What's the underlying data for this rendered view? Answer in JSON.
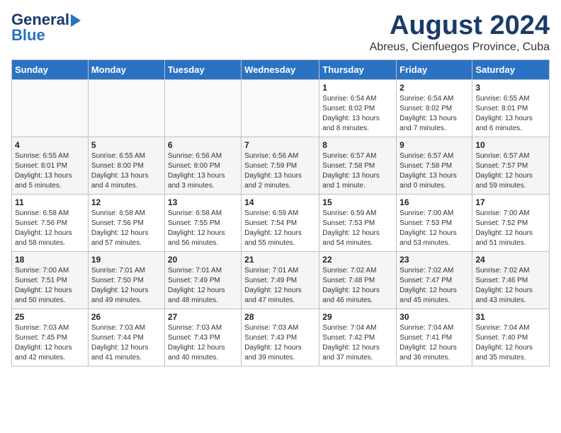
{
  "header": {
    "logo_line1": "General",
    "logo_line2": "Blue",
    "month_title": "August 2024",
    "subtitle": "Abreus, Cienfuegos Province, Cuba"
  },
  "days_of_week": [
    "Sunday",
    "Monday",
    "Tuesday",
    "Wednesday",
    "Thursday",
    "Friday",
    "Saturday"
  ],
  "weeks": [
    [
      {
        "day": "",
        "info": ""
      },
      {
        "day": "",
        "info": ""
      },
      {
        "day": "",
        "info": ""
      },
      {
        "day": "",
        "info": ""
      },
      {
        "day": "1",
        "info": "Sunrise: 6:54 AM\nSunset: 8:02 PM\nDaylight: 13 hours\nand 8 minutes."
      },
      {
        "day": "2",
        "info": "Sunrise: 6:54 AM\nSunset: 8:02 PM\nDaylight: 13 hours\nand 7 minutes."
      },
      {
        "day": "3",
        "info": "Sunrise: 6:55 AM\nSunset: 8:01 PM\nDaylight: 13 hours\nand 6 minutes."
      }
    ],
    [
      {
        "day": "4",
        "info": "Sunrise: 6:55 AM\nSunset: 8:01 PM\nDaylight: 13 hours\nand 5 minutes."
      },
      {
        "day": "5",
        "info": "Sunrise: 6:55 AM\nSunset: 8:00 PM\nDaylight: 13 hours\nand 4 minutes."
      },
      {
        "day": "6",
        "info": "Sunrise: 6:56 AM\nSunset: 8:00 PM\nDaylight: 13 hours\nand 3 minutes."
      },
      {
        "day": "7",
        "info": "Sunrise: 6:56 AM\nSunset: 7:59 PM\nDaylight: 13 hours\nand 2 minutes."
      },
      {
        "day": "8",
        "info": "Sunrise: 6:57 AM\nSunset: 7:58 PM\nDaylight: 13 hours\nand 1 minute."
      },
      {
        "day": "9",
        "info": "Sunrise: 6:57 AM\nSunset: 7:58 PM\nDaylight: 13 hours\nand 0 minutes."
      },
      {
        "day": "10",
        "info": "Sunrise: 6:57 AM\nSunset: 7:57 PM\nDaylight: 12 hours\nand 59 minutes."
      }
    ],
    [
      {
        "day": "11",
        "info": "Sunrise: 6:58 AM\nSunset: 7:56 PM\nDaylight: 12 hours\nand 58 minutes."
      },
      {
        "day": "12",
        "info": "Sunrise: 6:58 AM\nSunset: 7:56 PM\nDaylight: 12 hours\nand 57 minutes."
      },
      {
        "day": "13",
        "info": "Sunrise: 6:58 AM\nSunset: 7:55 PM\nDaylight: 12 hours\nand 56 minutes."
      },
      {
        "day": "14",
        "info": "Sunrise: 6:59 AM\nSunset: 7:54 PM\nDaylight: 12 hours\nand 55 minutes."
      },
      {
        "day": "15",
        "info": "Sunrise: 6:59 AM\nSunset: 7:53 PM\nDaylight: 12 hours\nand 54 minutes."
      },
      {
        "day": "16",
        "info": "Sunrise: 7:00 AM\nSunset: 7:53 PM\nDaylight: 12 hours\nand 53 minutes."
      },
      {
        "day": "17",
        "info": "Sunrise: 7:00 AM\nSunset: 7:52 PM\nDaylight: 12 hours\nand 51 minutes."
      }
    ],
    [
      {
        "day": "18",
        "info": "Sunrise: 7:00 AM\nSunset: 7:51 PM\nDaylight: 12 hours\nand 50 minutes."
      },
      {
        "day": "19",
        "info": "Sunrise: 7:01 AM\nSunset: 7:50 PM\nDaylight: 12 hours\nand 49 minutes."
      },
      {
        "day": "20",
        "info": "Sunrise: 7:01 AM\nSunset: 7:49 PM\nDaylight: 12 hours\nand 48 minutes."
      },
      {
        "day": "21",
        "info": "Sunrise: 7:01 AM\nSunset: 7:49 PM\nDaylight: 12 hours\nand 47 minutes."
      },
      {
        "day": "22",
        "info": "Sunrise: 7:02 AM\nSunset: 7:48 PM\nDaylight: 12 hours\nand 46 minutes."
      },
      {
        "day": "23",
        "info": "Sunrise: 7:02 AM\nSunset: 7:47 PM\nDaylight: 12 hours\nand 45 minutes."
      },
      {
        "day": "24",
        "info": "Sunrise: 7:02 AM\nSunset: 7:46 PM\nDaylight: 12 hours\nand 43 minutes."
      }
    ],
    [
      {
        "day": "25",
        "info": "Sunrise: 7:03 AM\nSunset: 7:45 PM\nDaylight: 12 hours\nand 42 minutes."
      },
      {
        "day": "26",
        "info": "Sunrise: 7:03 AM\nSunset: 7:44 PM\nDaylight: 12 hours\nand 41 minutes."
      },
      {
        "day": "27",
        "info": "Sunrise: 7:03 AM\nSunset: 7:43 PM\nDaylight: 12 hours\nand 40 minutes."
      },
      {
        "day": "28",
        "info": "Sunrise: 7:03 AM\nSunset: 7:43 PM\nDaylight: 12 hours\nand 39 minutes."
      },
      {
        "day": "29",
        "info": "Sunrise: 7:04 AM\nSunset: 7:42 PM\nDaylight: 12 hours\nand 37 minutes."
      },
      {
        "day": "30",
        "info": "Sunrise: 7:04 AM\nSunset: 7:41 PM\nDaylight: 12 hours\nand 36 minutes."
      },
      {
        "day": "31",
        "info": "Sunrise: 7:04 AM\nSunset: 7:40 PM\nDaylight: 12 hours\nand 35 minutes."
      }
    ]
  ]
}
